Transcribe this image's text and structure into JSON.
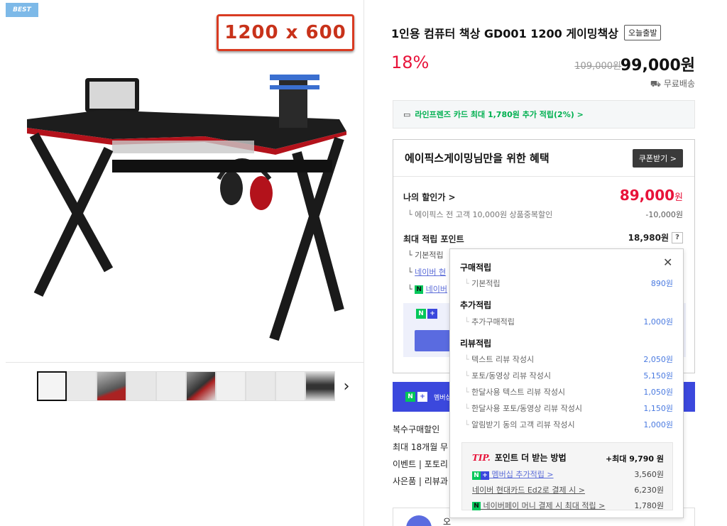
{
  "badge": {
    "best": "BEST"
  },
  "image": {
    "size_label": "1200 x 600"
  },
  "product": {
    "title": "1인용 컴퓨터 책상 GD001 1200 게이밍책상",
    "today_badge": "오늘출발",
    "discount_pct": "18%",
    "original_price": "109,000원",
    "sale_price": "99,000원",
    "shipping": "무료배송"
  },
  "card_banner": "라인프렌즈 카드 최대 1,780원 추가 적립(2%) >",
  "benefit": {
    "title": "에이픽스게이밍님만을 위한 혜택",
    "coupon_button": "쿠폰받기 >",
    "my_discount_label": "나의 할인가 >",
    "my_discount_price": "89,000",
    "my_discount_unit": "원",
    "all_customer_label": "에이픽스 전 고객 10,000원 상품중복할인",
    "all_customer_amount": "-10,000원",
    "max_point_label": "최대 적립 포인트",
    "max_point_amount": "18,980원",
    "help": "?",
    "sub_base": "기본적립",
    "sub_naver": "네이버 현",
    "sub_npay": "네이버"
  },
  "member_banner": {
    "label": "멤버십"
  },
  "info_lines": [
    "복수구매할인",
    "최대 18개월 무",
    "이벤트 | 포토리",
    "사은품 | 리뷰과"
  ],
  "bottom": {
    "text": "오"
  },
  "tooltip": {
    "purchase_title": "구매적립",
    "purchase_rows": [
      {
        "label": "기본적립",
        "value": "890원"
      }
    ],
    "extra_title": "추가적립",
    "extra_rows": [
      {
        "label": "추가구매적립",
        "value": "1,000원"
      }
    ],
    "review_title": "리뷰적립",
    "review_rows": [
      {
        "label": "텍스트 리뷰 작성시",
        "value": "2,050원"
      },
      {
        "label": "포토/동영상 리뷰 작성시",
        "value": "5,150원"
      },
      {
        "label": "한달사용 텍스트 리뷰 작성시",
        "value": "1,050원"
      },
      {
        "label": "한달사용 포토/동영상 리뷰 작성시",
        "value": "1,150원"
      },
      {
        "label": "알림받기 동의 고객 리뷰 작성시",
        "value": "1,000원"
      }
    ],
    "tip_label": "TIP.",
    "tip_title": "포인트 더 받는 방법",
    "tip_max": "+최대 9,790 원",
    "tip_rows": [
      {
        "label": "멤버십 추가적립 >",
        "value": "3,560원"
      },
      {
        "label": "네이버 현대카드 Ed2로 결제 시 >",
        "value": "6,230원"
      },
      {
        "label": "네이버페이 머니 결제 시 최대 적립 >",
        "value": "1,780원"
      }
    ]
  },
  "colors": {
    "accent_red": "#e8133a",
    "naver_green": "#03c75a",
    "blue": "#3b48dd"
  }
}
